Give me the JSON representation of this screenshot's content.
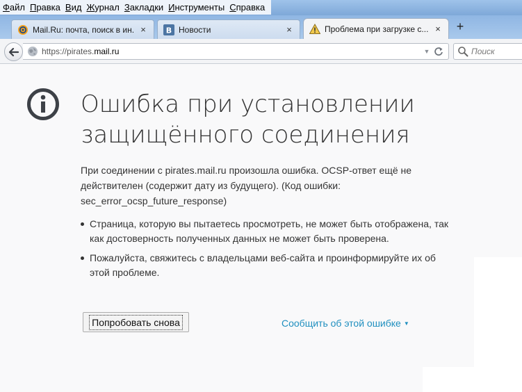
{
  "menu": {
    "items": [
      {
        "first": "Ф",
        "rest": "айл"
      },
      {
        "first": "П",
        "rest": "равка"
      },
      {
        "first": "В",
        "rest": "ид"
      },
      {
        "first": "Ж",
        "rest": "урнал"
      },
      {
        "first": "З",
        "rest": "акладки"
      },
      {
        "first": "И",
        "rest": "нструменты"
      },
      {
        "first": "С",
        "rest": "правка"
      }
    ]
  },
  "tabs": [
    {
      "title": "Mail.Ru: почта, поиск в ин...",
      "close": "×"
    },
    {
      "title": "Новости",
      "close": "×"
    },
    {
      "title": "Проблема при загрузке с...",
      "close": "×"
    }
  ],
  "new_tab": "+",
  "navbar": {
    "url_prefix": "https://pirates.",
    "url_host": "mail.ru",
    "dropdown": "▼",
    "search_placeholder": "Поиск"
  },
  "error": {
    "title": "Ошибка при установлении защищённого соединения",
    "description": "При соединении с pirates.mail.ru произошла ошибка. OCSP-ответ ещё не действителен (содержит дату из будущего). (Код ошибки: sec_error_ocsp_future_response)",
    "bullets": [
      "Страница, которую вы пытаетесь просмотреть, не может быть отображена, так как достоверность полученных данных не может быть проверена.",
      "Пожалуйста, свяжитесь с владельцами веб-сайта и проинформируйте их об этой проблеме."
    ],
    "try_again": "Попробовать снова",
    "report": "Сообщить об этой ошибке",
    "report_caret": "▼"
  },
  "colors": {
    "link": "#1f8fbf",
    "text": "#333333",
    "background": "#f9f9fa"
  }
}
